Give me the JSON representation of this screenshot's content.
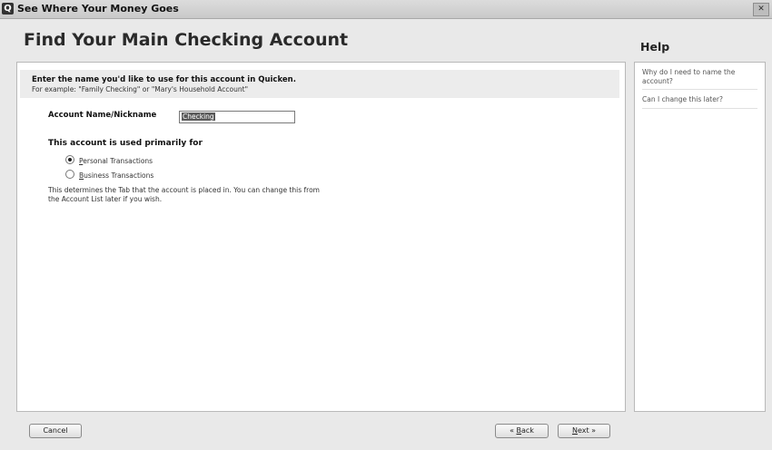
{
  "window": {
    "title": "See Where Your Money Goes",
    "app_icon": "Q",
    "close_glyph": "✕"
  },
  "page": {
    "title": "Find Your Main Checking Account"
  },
  "intro": {
    "heading": "Enter the name you'd like to use for this account in Quicken.",
    "example": "For example: \"Family Checking\" or \"Mary's Household Account\""
  },
  "account": {
    "label": "Account Name/Nickname",
    "value": "Checking"
  },
  "usage": {
    "heading": "This account is used primarily for",
    "options": [
      {
        "label_first": "P",
        "label_rest": "ersonal Transactions",
        "selected": true
      },
      {
        "label_first": "B",
        "label_rest": "usiness Transactions",
        "selected": false
      }
    ],
    "note": "This determines the Tab that the account is placed in. You can change this from the Account List later if you wish."
  },
  "help": {
    "title": "Help",
    "items": [
      "Why do I need to name the account?",
      "Can I change this later?"
    ]
  },
  "buttons": {
    "cancel": "Cancel",
    "back_prefix": "« ",
    "back_first": "B",
    "back_rest": "ack",
    "next_first": "N",
    "next_rest": "ext",
    "next_suffix": " »"
  }
}
